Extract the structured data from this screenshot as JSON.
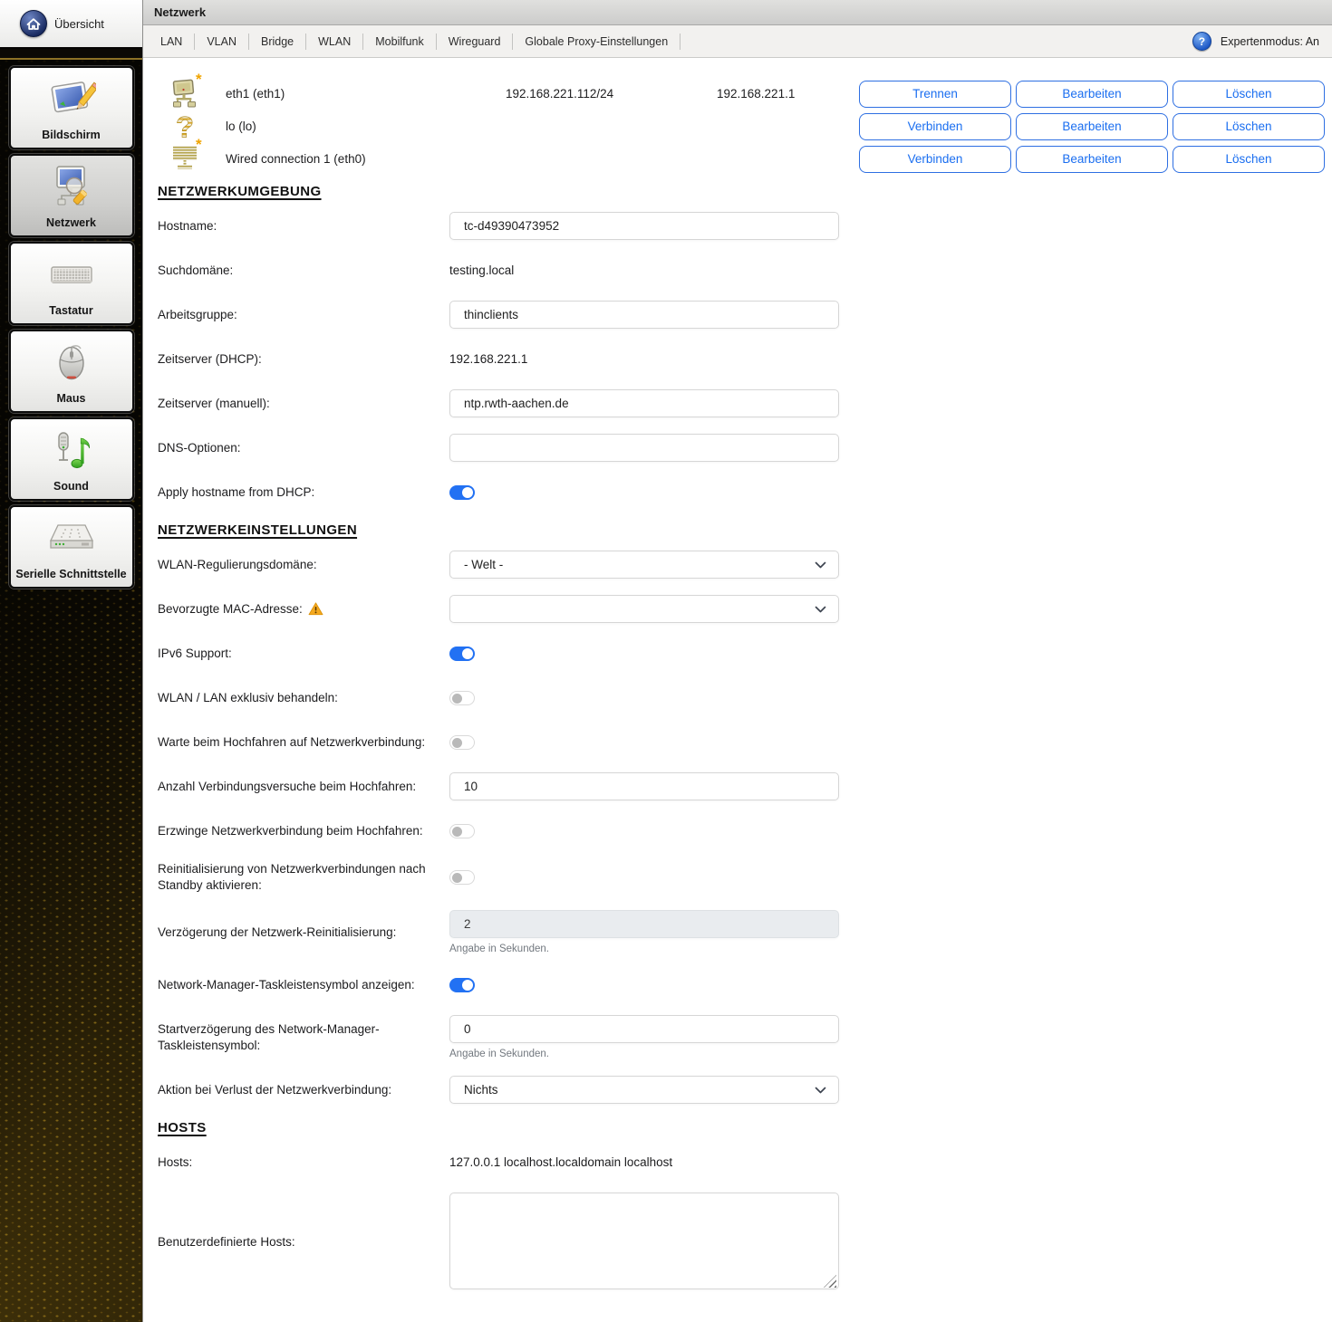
{
  "window": {
    "title": "Netzwerk",
    "help_icon": "?",
    "expert_mode_label": "Expertenmodus: An"
  },
  "sidebar": {
    "overview_label": "Übersicht",
    "items": [
      {
        "label": "Bildschirm",
        "icon": "display-icon",
        "selected": false
      },
      {
        "label": "Netzwerk",
        "icon": "network-icon",
        "selected": true
      },
      {
        "label": "Tastatur",
        "icon": "keyboard-icon",
        "selected": false
      },
      {
        "label": "Maus",
        "icon": "mouse-icon",
        "selected": false
      },
      {
        "label": "Sound",
        "icon": "sound-icon",
        "selected": false
      },
      {
        "label": "Serielle Schnittstelle",
        "icon": "serial-port-icon",
        "selected": false
      }
    ]
  },
  "tabs": [
    {
      "label": "LAN"
    },
    {
      "label": "VLAN"
    },
    {
      "label": "Bridge"
    },
    {
      "label": "WLAN"
    },
    {
      "label": "Mobilfunk"
    },
    {
      "label": "Wireguard"
    },
    {
      "label": "Globale Proxy-Einstellungen"
    }
  ],
  "interfaces": [
    {
      "name": "eth1 (eth1)",
      "ip": "192.168.221.112/24",
      "gateway": "192.168.221.1",
      "new_marker": "*",
      "buttons": [
        "Trennen",
        "Bearbeiten",
        "Löschen"
      ]
    },
    {
      "name": "lo (lo)",
      "ip": "",
      "gateway": "",
      "buttons": [
        "Verbinden",
        "Bearbeiten",
        "Löschen"
      ]
    },
    {
      "name": "Wired connection 1 (eth0)",
      "ip": "",
      "gateway": "",
      "new_marker": "*",
      "buttons": [
        "Verbinden",
        "Bearbeiten",
        "Löschen"
      ]
    }
  ],
  "sections": {
    "network_environment": {
      "title": "NETZWERKUMGEBUNG"
    },
    "network_settings": {
      "title": "NETZWERKEINSTELLUNGEN"
    },
    "hosts": {
      "title": "HOSTS"
    }
  },
  "fields": {
    "hostname": {
      "label": "Hostname:",
      "value": "tc-d49390473952"
    },
    "search_domain": {
      "label": "Suchdomäne:",
      "value": "testing.local"
    },
    "workgroup": {
      "label": "Arbeitsgruppe:",
      "value": "thinclients"
    },
    "timeserver_dhcp": {
      "label": "Zeitserver (DHCP):",
      "value": "192.168.221.1"
    },
    "timeserver_manual": {
      "label": "Zeitserver (manuell):",
      "value": "ntp.rwth-aachen.de"
    },
    "dns_options": {
      "label": "DNS-Optionen:",
      "value": ""
    },
    "apply_hostname_dhcp": {
      "label": "Apply hostname from DHCP:",
      "state": "on"
    },
    "wlan_regulatory_domain": {
      "label": "WLAN-Regulierungsdomäne:",
      "value": "- Welt -"
    },
    "preferred_mac": {
      "label": "Bevorzugte MAC-Adresse:",
      "value": "",
      "warning": true
    },
    "ipv6_support": {
      "label": "IPv6 Support:",
      "state": "on"
    },
    "wlan_lan_exclusive": {
      "label": "WLAN / LAN exklusiv behandeln:",
      "state": "off"
    },
    "wait_network_boot": {
      "label": "Warte beim Hochfahren auf Netzwerkverbindung:",
      "state": "off"
    },
    "connection_attempts": {
      "label": "Anzahl Verbindungsversuche beim Hochfahren:",
      "value": "10"
    },
    "force_network_boot": {
      "label": "Erzwinge Netzwerkverbindung beim Hochfahren:",
      "state": "off"
    },
    "reinit_after_standby": {
      "label": "Reinitialisierung von Netzwerkverbindungen nach Standby aktivieren:",
      "state": "off"
    },
    "reinit_delay": {
      "label": "Verzögerung der Netzwerk-Reinitialisierung:",
      "value": "2",
      "helper": "Angabe in Sekunden.",
      "disabled": true
    },
    "nm_tray_icon": {
      "label": "Network-Manager-Taskleistensymbol anzeigen:",
      "state": "on"
    },
    "nm_tray_delay": {
      "label": "Startverzögerung des Network-Manager-Taskleistensymbol:",
      "value": "0",
      "helper": "Angabe in Sekunden."
    },
    "connection_loss_action": {
      "label": "Aktion bei Verlust der Netzwerkverbindung:",
      "value": "Nichts"
    },
    "hosts": {
      "label": "Hosts:",
      "value": "127.0.0.1 localhost.localdomain localhost"
    },
    "custom_hosts": {
      "label": "Benutzerdefinierte Hosts:",
      "value": ""
    }
  },
  "colors": {
    "accent_blue": "#1a6ef0",
    "toggle_on_blue": "#2271f3",
    "warning_orange": "#f5a91f",
    "gold_accent": "#c9a227"
  }
}
